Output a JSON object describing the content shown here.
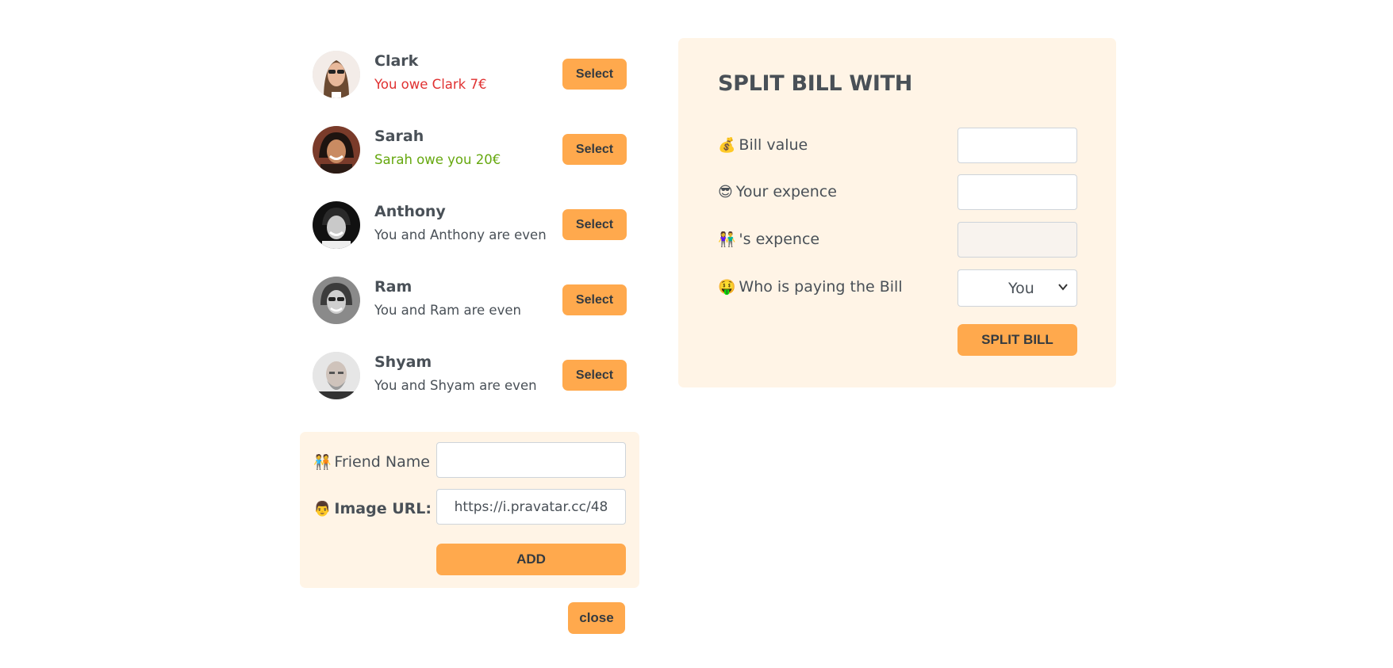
{
  "friends": [
    {
      "name": "Clark",
      "status": "You owe Clark 7€",
      "status_kind": "owe",
      "button": "Select",
      "avatar_icon": "clark-avatar"
    },
    {
      "name": "Sarah",
      "status": "Sarah owe you 20€",
      "status_kind": "owed",
      "button": "Select",
      "avatar_icon": "sarah-avatar"
    },
    {
      "name": "Anthony",
      "status": "You and Anthony are even",
      "status_kind": "even",
      "button": "Select",
      "avatar_icon": "anthony-avatar"
    },
    {
      "name": "Ram",
      "status": "You and Ram are even",
      "status_kind": "even",
      "button": "Select",
      "avatar_icon": "ram-avatar"
    },
    {
      "name": "Shyam",
      "status": "You and Shyam are even",
      "status_kind": "even",
      "button": "Select",
      "avatar_icon": "shyam-avatar"
    }
  ],
  "add_friend": {
    "name_label": "Friend Name",
    "name_value": "",
    "image_label": "Image URL:",
    "image_value": "https://i.pravatar.cc/48",
    "add_button": "ADD",
    "name_emoji": "🧑‍🤝‍🧑",
    "image_emoji": "👨"
  },
  "close_button": "close",
  "split": {
    "title": "SPLIT BILL WITH",
    "bill_label": "Bill value",
    "bill_emoji": "💰",
    "bill_value": "",
    "your_expense_label": "Your expence",
    "your_expense_emoji": "😎",
    "your_expense_value": "",
    "friend_expense_label": "'s expence",
    "friend_expense_emoji": "👫",
    "friend_expense_value": "",
    "payer_label": "Who is paying the Bill",
    "payer_emoji": "🤑",
    "payer_value": "You",
    "split_button": "SPLIT BILL"
  },
  "colors": {
    "accent": "#ffa94d",
    "panel": "#fff4e6",
    "text": "#495057",
    "owe": "#e03131",
    "owed": "#66a80f"
  }
}
